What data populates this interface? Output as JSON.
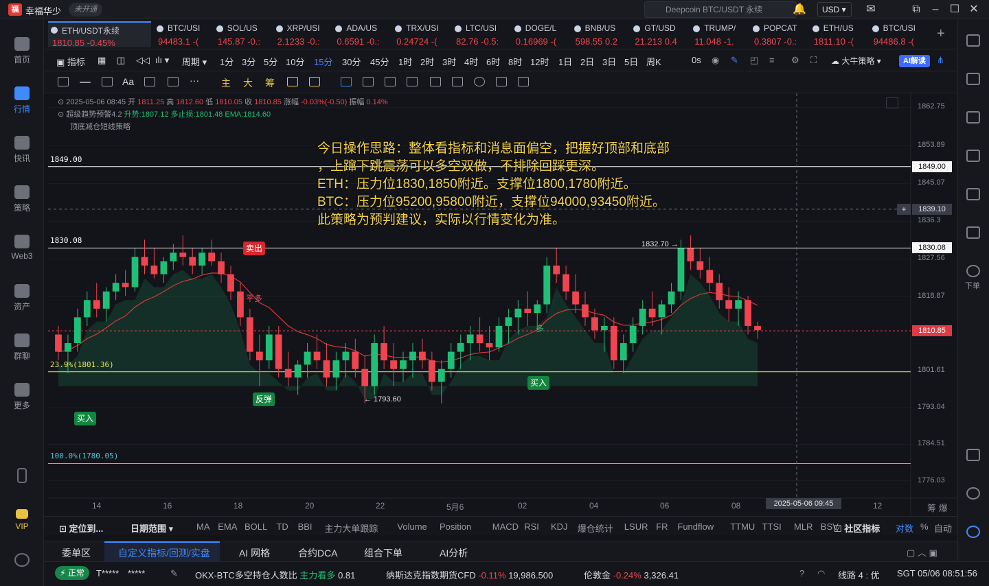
{
  "app": {
    "name": "幸福华少",
    "status_pill": "未开通",
    "search_placeholder": "Deepcoin BTC/USDT 永续",
    "currency": "USD"
  },
  "sidebar": [
    {
      "label": "首页",
      "icon": "home-icon"
    },
    {
      "label": "行情",
      "icon": "chart-bars-icon",
      "active": true
    },
    {
      "label": "快讯",
      "icon": "news-icon"
    },
    {
      "label": "策略",
      "icon": "robot-icon"
    },
    {
      "label": "Web3",
      "icon": "web3-icon"
    },
    {
      "label": "资产",
      "icon": "wallet-icon"
    },
    {
      "label": "群聊",
      "icon": "chat-icon"
    },
    {
      "label": "更多",
      "icon": "grid-icon"
    },
    {
      "label": "VIP",
      "icon": "diamond-icon"
    }
  ],
  "tabs": [
    {
      "symbol": "ETH/USDT永续",
      "price": "1810.85",
      "change": "-0.45%",
      "active": true
    },
    {
      "symbol": "BTC/USI",
      "price": "94483.1",
      "change": "-("
    },
    {
      "symbol": "SOL/US",
      "price": "145.87",
      "change": "-0.:"
    },
    {
      "symbol": "XRP/USI",
      "price": "2.1233",
      "change": "-0.:"
    },
    {
      "symbol": "ADA/US",
      "price": "0.6591",
      "change": "-0.:"
    },
    {
      "symbol": "TRX/USI",
      "price": "0.24724",
      "change": "-("
    },
    {
      "symbol": "LTC/USI",
      "price": "82.76",
      "change": "-0.5:"
    },
    {
      "symbol": "DOGE/L",
      "price": "0.16969",
      "change": "-("
    },
    {
      "symbol": "BNB/US",
      "price": "598.55",
      "change": "0.2"
    },
    {
      "symbol": "GT/USD",
      "price": "21.213",
      "change": "0.4"
    },
    {
      "symbol": "TRUMP/",
      "price": "11.048",
      "change": "-1."
    },
    {
      "symbol": "POPCAT",
      "price": "0.3807",
      "change": "-0.:"
    },
    {
      "symbol": "ETH/US",
      "price": "1811.10",
      "change": "-("
    },
    {
      "symbol": "BTC/USI",
      "price": "94486.8",
      "change": "-("
    }
  ],
  "toolbar": {
    "indicator": "指标",
    "period": "周期",
    "timeframes": [
      "1分",
      "3分",
      "5分",
      "10分",
      "15分",
      "30分",
      "45分",
      "1时",
      "2时",
      "3时",
      "4时",
      "6时",
      "8时",
      "12时",
      "1日",
      "2日",
      "3日",
      "5日",
      "周K"
    ],
    "active_timeframe": "15分",
    "zero_s": "0s",
    "strategy": "大牛策略",
    "ai": "AI解读"
  },
  "draw_tools": {
    "main": "主",
    "big": "大",
    "chip": "筹"
  },
  "legend": {
    "date": "2025-05-06 08:45",
    "open_label": "开",
    "open": "1811.25",
    "high_label": "高",
    "high": "1812.60",
    "low_label": "低",
    "low": "1810.05",
    "close_label": "收",
    "close": "1810.85",
    "chg_label": "涨幅",
    "chg": "-0.03%(-0.50)",
    "amp_label": "振幅",
    "amp": "0.14%",
    "ind1": "超级趋势预警4.2",
    "ind1_up": "升势:1807.12",
    "ind1_stop": "多止损:1801.48",
    "ind1_ema": "EMA:1814.60",
    "ind2": "顶底减仓短线策略"
  },
  "strategy_text": [
    "今日操作思路：整体看指标和消息面偏空，把握好顶部和底部",
    "，上蹿下跳震荡可以多空双做，不排除回踩更深。",
    "ETH：压力位1830,1850附近。支撑位1800,1780附近。",
    "BTC：压力位95200,95800附近，支撑位94000,93450附近。",
    "此策略为预判建议，实际以行情变化为准。"
  ],
  "chart_data": {
    "type": "candlestick",
    "symbol": "ETH/USDT永续",
    "interval": "15分",
    "y_ticks": [
      1862.75,
      1853.89,
      1845.07,
      1836.3,
      1827.56,
      1818.87,
      1801.61,
      1793.04,
      1784.51,
      1776.03
    ],
    "ylim": [
      1772,
      1866
    ],
    "x_ticks": [
      "14",
      "16",
      "18",
      "20",
      "22",
      "5月6",
      "02",
      "04",
      "06",
      "08",
      "12"
    ],
    "crosshair_time": "2025-05-06 09:45",
    "crosshair_price": "1839.10",
    "current_price": "1810.85",
    "horizontal_lines": [
      {
        "label": "1849.00",
        "value": 1849.0,
        "color": "#ffffff"
      },
      {
        "label": "1830.08",
        "value": 1830.08,
        "color": "#ffffff"
      },
      {
        "label": "23.9%(1801.36)",
        "value": 1801.36,
        "color": "#e8e84a"
      },
      {
        "label": "100.0%(1780.05)",
        "value": 1780.05,
        "color": "#4fc9e0"
      }
    ],
    "annotations": [
      {
        "text": "1832.70 →",
        "kind": "high"
      },
      {
        "text": "← 1793.60",
        "kind": "low"
      },
      {
        "text": "卖出",
        "kind": "sell"
      },
      {
        "text": "平多",
        "kind": "close-long"
      },
      {
        "text": "反弹",
        "kind": "rebound"
      },
      {
        "text": "买入",
        "kind": "buy"
      },
      {
        "text": "买入",
        "kind": "buy"
      },
      {
        "text": "多",
        "kind": "long"
      }
    ],
    "candles": [
      [
        1810,
        1812,
        1804,
        1806
      ],
      [
        1806,
        1810,
        1801,
        1808
      ],
      [
        1808,
        1816,
        1806,
        1814
      ],
      [
        1814,
        1820,
        1812,
        1818
      ],
      [
        1818,
        1822,
        1814,
        1816
      ],
      [
        1816,
        1821,
        1813,
        1820
      ],
      [
        1820,
        1824,
        1818,
        1822
      ],
      [
        1822,
        1825,
        1819,
        1821
      ],
      [
        1821,
        1830,
        1820,
        1828
      ],
      [
        1828,
        1832,
        1824,
        1826
      ],
      [
        1826,
        1830,
        1823,
        1824
      ],
      [
        1824,
        1828,
        1822,
        1827
      ],
      [
        1827,
        1831,
        1825,
        1829
      ],
      [
        1829,
        1833,
        1826,
        1828
      ],
      [
        1828,
        1830,
        1824,
        1826
      ],
      [
        1826,
        1830,
        1824,
        1829
      ],
      [
        1829,
        1832,
        1826,
        1827
      ],
      [
        1827,
        1829,
        1822,
        1824
      ],
      [
        1824,
        1826,
        1818,
        1820
      ],
      [
        1820,
        1822,
        1812,
        1814
      ],
      [
        1814,
        1816,
        1804,
        1806
      ],
      [
        1806,
        1810,
        1798,
        1804
      ],
      [
        1804,
        1812,
        1802,
        1810
      ],
      [
        1810,
        1812,
        1800,
        1802
      ],
      [
        1802,
        1806,
        1798,
        1800
      ],
      [
        1800,
        1804,
        1796,
        1803
      ],
      [
        1803,
        1808,
        1800,
        1806
      ],
      [
        1806,
        1810,
        1802,
        1804
      ],
      [
        1804,
        1808,
        1798,
        1800
      ],
      [
        1800,
        1806,
        1797,
        1804
      ],
      [
        1804,
        1808,
        1800,
        1806
      ],
      [
        1806,
        1809,
        1800,
        1802
      ],
      [
        1802,
        1805,
        1794,
        1798
      ],
      [
        1798,
        1810,
        1796,
        1808
      ],
      [
        1808,
        1812,
        1802,
        1804
      ],
      [
        1804,
        1808,
        1798,
        1802
      ],
      [
        1802,
        1806,
        1799,
        1804
      ],
      [
        1804,
        1808,
        1800,
        1806
      ],
      [
        1806,
        1809,
        1802,
        1804
      ],
      [
        1804,
        1806,
        1797,
        1799
      ],
      [
        1799,
        1804,
        1794,
        1802
      ],
      [
        1802,
        1808,
        1800,
        1806
      ],
      [
        1806,
        1810,
        1802,
        1808
      ],
      [
        1808,
        1812,
        1804,
        1810
      ],
      [
        1810,
        1814,
        1806,
        1808
      ],
      [
        1808,
        1812,
        1804,
        1807
      ],
      [
        1807,
        1814,
        1806,
        1812
      ],
      [
        1812,
        1816,
        1808,
        1814
      ],
      [
        1814,
        1818,
        1810,
        1816
      ],
      [
        1816,
        1820,
        1812,
        1815
      ],
      [
        1815,
        1818,
        1811,
        1817
      ],
      [
        1817,
        1828,
        1815,
        1826
      ],
      [
        1826,
        1830,
        1822,
        1824
      ],
      [
        1824,
        1826,
        1818,
        1820
      ],
      [
        1820,
        1824,
        1815,
        1817
      ],
      [
        1817,
        1820,
        1812,
        1814
      ],
      [
        1814,
        1816,
        1809,
        1811
      ],
      [
        1811,
        1814,
        1806,
        1812
      ],
      [
        1812,
        1814,
        1802,
        1804
      ],
      [
        1804,
        1810,
        1801,
        1808
      ],
      [
        1808,
        1814,
        1806,
        1812
      ],
      [
        1812,
        1818,
        1810,
        1816
      ],
      [
        1816,
        1820,
        1812,
        1814
      ],
      [
        1814,
        1818,
        1810,
        1817
      ],
      [
        1817,
        1822,
        1815,
        1820
      ],
      [
        1820,
        1832,
        1818,
        1830
      ],
      [
        1830,
        1833,
        1825,
        1827
      ],
      [
        1827,
        1830,
        1823,
        1825
      ],
      [
        1825,
        1828,
        1820,
        1822
      ],
      [
        1822,
        1824,
        1816,
        1818
      ],
      [
        1818,
        1821,
        1813,
        1816
      ],
      [
        1816,
        1820,
        1812,
        1818
      ],
      [
        1818,
        1819,
        1810,
        1812
      ],
      [
        1812,
        1813,
        1809,
        1811
      ]
    ]
  },
  "indicators": {
    "locate": "定位到...",
    "date_range": "日期范围",
    "items": [
      "MA",
      "EMA",
      "BOLL",
      "TD",
      "BBI",
      "主力大单跟踪",
      "Volume",
      "Position",
      "MACD",
      "RSI",
      "KDJ",
      "爆仓统计",
      "LSUR",
      "FR",
      "Fundflow",
      "TTMU",
      "TTSI",
      "MLR",
      "BSV"
    ],
    "community": "社区指标",
    "log": "对数",
    "pct": "%",
    "auto": "自动"
  },
  "panel_tabs": [
    "委单区",
    "自定义指标/回测/实盘",
    "AI 网格",
    "合约DCA",
    "组合下单",
    "AI分析"
  ],
  "active_panel_tab": "自定义指标/回测/实盘",
  "status": {
    "normal": "正常",
    "masked1": "T*****",
    "masked2": "*****",
    "item1_label": "OKX-BTC多空持仓人数比",
    "item1_tag": "主力看多",
    "item1_value": "0.81",
    "item2_label": "纳斯达克指数期货CFD",
    "item2_change": "-0.11%",
    "item2_value": "19,986.500",
    "item3_label": "伦敦金",
    "item3_change": "-0.24%",
    "item3_value": "3,326.41",
    "line": "线路 4 : 优",
    "time": "SGT 05/06 08:51:56"
  },
  "colors": {
    "up": "#1fbf75",
    "down": "#f0444f",
    "accent": "#3d8bff",
    "strategy_text": "#f2d14a"
  }
}
